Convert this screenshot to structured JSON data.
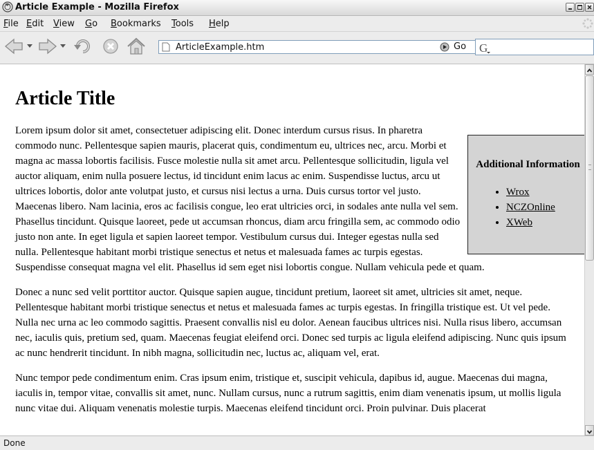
{
  "window": {
    "title": "Article Example - Mozilla Firefox",
    "icon": "firefox-icon"
  },
  "menubar": {
    "items": [
      "File",
      "Edit",
      "View",
      "Go",
      "Bookmarks",
      "Tools",
      "Help"
    ]
  },
  "navbar": {
    "url": "ArticleExample.htm",
    "go_label": "Go",
    "icons": [
      "back-icon",
      "forward-icon",
      "reload-icon",
      "stop-icon",
      "home-icon",
      "go-icon",
      "search-engine-icon"
    ]
  },
  "article": {
    "title": "Article Title",
    "paragraphs": [
      "Lorem ipsum dolor sit amet, consectetuer adipiscing elit. Donec interdum cursus risus. In pharetra commodo nunc. Pellentesque sapien mauris, placerat quis, condimentum eu, ultrices nec, arcu. Morbi et magna ac massa lobortis facilisis. Fusce molestie nulla sit amet arcu. Pellentesque sollicitudin, ligula vel auctor aliquam, enim nulla posuere lectus, id tincidunt enim lacus ac enim. Suspendisse luctus, arcu ut ultrices lobortis, dolor ante volutpat justo, et cursus nisi lectus a urna. Duis cursus tortor vel justo. Maecenas libero. Nam lacinia, eros ac facilisis congue, leo erat ultricies orci, in sodales ante nulla vel sem. Phasellus tincidunt. Quisque laoreet, pede ut accumsan rhoncus, diam arcu fringilla sem, ac commodo odio justo non ante. In eget ligula et sapien laoreet tempor. Vestibulum cursus dui. Integer egestas nulla sed nulla. Pellentesque habitant morbi tristique senectus et netus et malesuada fames ac turpis egestas. Suspendisse consequat magna vel elit. Phasellus id sem eget nisi lobortis congue. Nullam vehicula pede et quam.",
      "Donec a nunc sed velit porttitor auctor. Quisque sapien augue, tincidunt pretium, laoreet sit amet, ultricies sit amet, neque. Pellentesque habitant morbi tristique senectus et netus et malesuada fames ac turpis egestas. In fringilla tristique est. Ut vel pede. Nulla nec urna ac leo commodo sagittis. Praesent convallis nisl eu dolor. Aenean faucibus ultrices nisi. Nulla risus libero, accumsan nec, iaculis quis, pretium sed, quam. Maecenas feugiat eleifend orci. Donec sed turpis ac ligula eleifend adipiscing. Nunc quis ipsum ac nunc hendrerit tincidunt. In nibh magna, sollicitudin nec, luctus ac, aliquam vel, erat.",
      "Nunc tempor pede condimentum enim. Cras ipsum enim, tristique et, suscipit vehicula, dapibus id, augue. Maecenas dui magna, iaculis in, tempor vitae, convallis sit amet, nunc. Nullam cursus, nunc a rutrum sagittis, enim diam venenatis ipsum, ut mollis ligula nunc vitae dui. Aliquam venenatis molestie turpis. Maecenas eleifend tincidunt orci. Proin pulvinar. Duis placerat"
    ],
    "sidebox": {
      "title": "Additional Information",
      "links": [
        "Wrox",
        "NCZOnline",
        "XWeb"
      ]
    }
  },
  "statusbar": {
    "text": "Done"
  },
  "colors": {
    "sidebox_bg": "#d4d4d4",
    "chrome_bg": "#ececec",
    "content_bg": "#ffffff"
  }
}
